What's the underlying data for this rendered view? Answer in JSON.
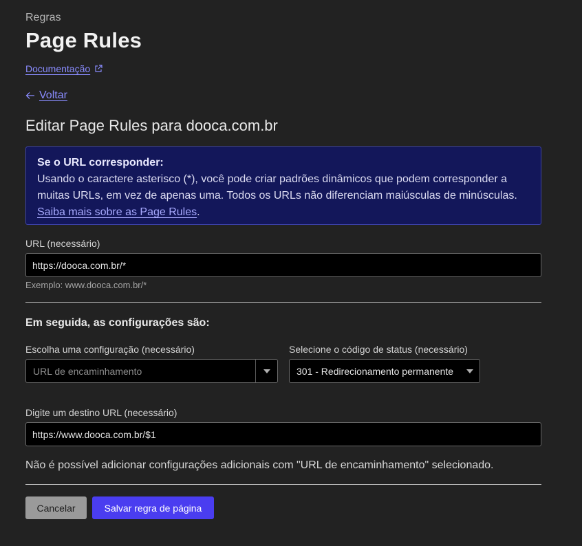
{
  "header": {
    "eyebrow": "Regras",
    "title": "Page Rules",
    "doc_link": "Documentação",
    "back_link": "Voltar"
  },
  "edit_title": "Editar Page Rules para dooca.com.br",
  "info_box": {
    "heading": "Se o URL corresponder:",
    "body": "Usando o caractere asterisco (*), você pode criar padrões dinâmicos que podem corresponder a muitas URLs, em vez de apenas uma. Todos os URLs não diferenciam maiúsculas de minúsculas.",
    "link": "Saiba mais sobre as Page Rules",
    "link_suffix": "."
  },
  "url_field": {
    "label": "URL (necessário)",
    "value": "https://dooca.com.br/*",
    "example": "Exemplo: www.dooca.com.br/*"
  },
  "settings": {
    "heading": "Em seguida, as configurações são:",
    "config_label": "Escolha uma configuração (necessário)",
    "config_value": "URL de encaminhamento",
    "status_label": "Selecione o código de status (necessário)",
    "status_value": "301 - Redirecionamento permanente",
    "dest_label": "Digite um destino URL (necessário)",
    "dest_value": "https://www.dooca.com.br/$1",
    "note": "Não é possível adicionar configurações adicionais com \"URL de encaminhamento\" selecionado."
  },
  "actions": {
    "cancel": "Cancelar",
    "save": "Salvar regra de página"
  },
  "colors": {
    "background": "#222222",
    "link": "#8a8cff",
    "info_bg": "#13175a",
    "primary": "#4a3df0"
  }
}
